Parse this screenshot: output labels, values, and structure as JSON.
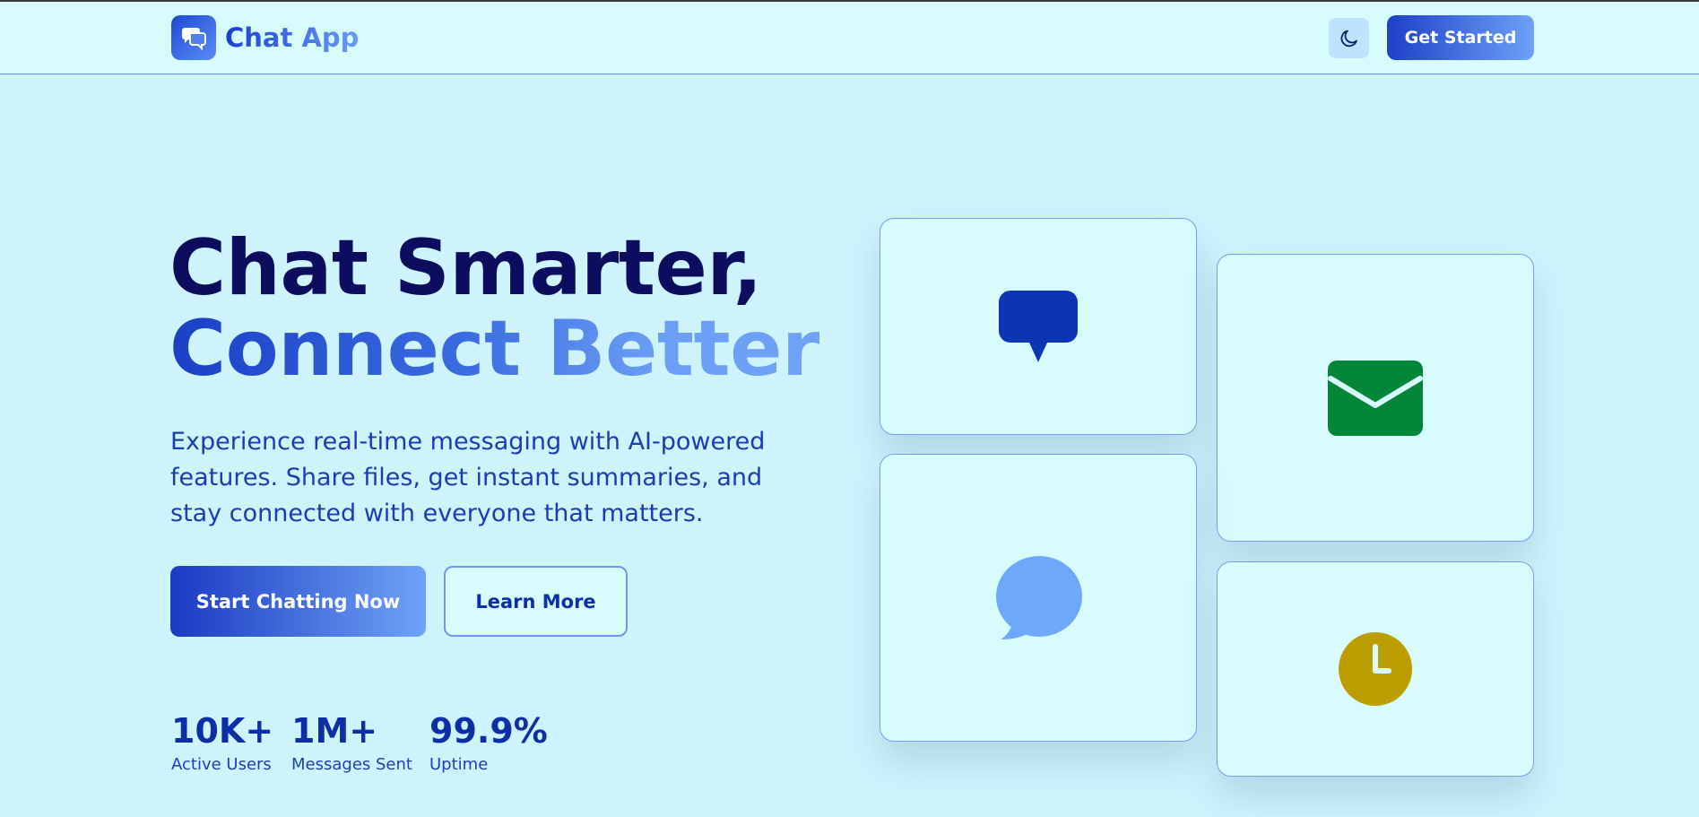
{
  "header": {
    "brand_name": "Chat App",
    "logo_icon": "chat-bubbles-icon",
    "theme_icon": "moon-icon",
    "cta_label": "Get Started"
  },
  "hero": {
    "title_line1": "Chat Smarter,",
    "title_line2": "Connect Better",
    "description": "Experience real-time messaging with AI-powered features. Share files, get instant summaries, and stay connected with everyone that matters.",
    "primary_button": "Start Chatting Now",
    "secondary_button": "Learn More"
  },
  "stats": [
    {
      "value": "10K+",
      "label": "Active Users"
    },
    {
      "value": "1M+",
      "label": "Messages Sent"
    },
    {
      "value": "99.9%",
      "label": "Uptime"
    }
  ],
  "feature_cards": [
    {
      "icon": "speech-bubble-icon",
      "color": "#0b35b5"
    },
    {
      "icon": "envelope-icon",
      "color": "#038637"
    },
    {
      "icon": "chat-bubble-icon",
      "color": "#6ea8fb"
    },
    {
      "icon": "clock-icon",
      "color": "#bd9e01"
    }
  ],
  "colors": {
    "background": "#cff3fd",
    "header_bg": "#d8fcfd",
    "title_dark": "#0c0d5e",
    "accent_blue": "#1a3fc6",
    "accent_light": "#6ea2f6"
  }
}
